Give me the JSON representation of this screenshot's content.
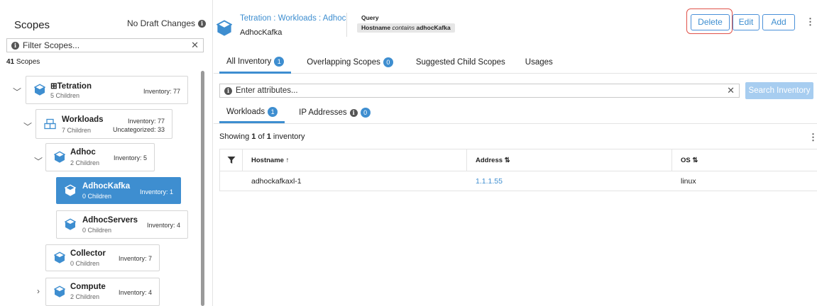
{
  "left": {
    "title": "Scopes",
    "draft_status": "No Draft Changes",
    "filter_placeholder": "Filter Scopes...",
    "scope_count_num": "41",
    "scope_count_label": "Scopes",
    "tree": [
      {
        "name": "Tetration",
        "prefix": "⊞",
        "children": "5 Children",
        "inventory": "Inventory: 77",
        "expanded": true
      },
      {
        "name": "Workloads",
        "children": "7 Children",
        "inventory": "Inventory: 77",
        "uncategorized": "Uncategorized: 33",
        "expanded": true
      },
      {
        "name": "Adhoc",
        "children": "2 Children",
        "inventory": "Inventory: 5",
        "expanded": true
      },
      {
        "name": "AdhocKafka",
        "children": "0 Children",
        "inventory": "Inventory: 1",
        "selected": true
      },
      {
        "name": "AdhocServers",
        "children": "0 Children",
        "inventory": "Inventory: 4"
      },
      {
        "name": "Collector",
        "children": "0 Children",
        "inventory": "Inventory: 7"
      },
      {
        "name": "Compute",
        "children": "2 Children",
        "inventory": "Inventory: 4",
        "expanded": false
      }
    ]
  },
  "header": {
    "breadcrumb": [
      "Tetration",
      "Workloads",
      "Adhoc"
    ],
    "breadcrumb_sep": " : ",
    "scope_name": "AdhocKafka",
    "query_title": "Query",
    "query_field": "Hostname",
    "query_op": "contains",
    "query_value": "adhocKafka",
    "buttons": {
      "delete": "Delete",
      "edit": "Edit",
      "add": "Add"
    }
  },
  "tabs": [
    {
      "label": "All Inventory",
      "badge": "1",
      "active": true
    },
    {
      "label": "Overlapping Scopes",
      "badge": "0"
    },
    {
      "label": "Suggested Child Scopes"
    },
    {
      "label": "Usages"
    }
  ],
  "inventory": {
    "attr_placeholder": "Enter attributes...",
    "search_button": "Search Inventory",
    "subtabs": [
      {
        "label": "Workloads",
        "badge": "1",
        "active": true
      },
      {
        "label": "IP Addresses",
        "badge": "0",
        "info": true
      }
    ],
    "showing_prefix": "Showing",
    "showing_count": "1",
    "showing_of": "of",
    "showing_total": "1",
    "showing_suffix": "inventory",
    "columns": [
      "Hostname ↑",
      "Address ⇅",
      "OS ⇅"
    ],
    "rows": [
      {
        "hostname": "adhockafkaxl-1",
        "address": "1.1.1.55",
        "os": "linux"
      }
    ]
  },
  "colors": {
    "accent": "#3e8ed0",
    "highlight": "#e0524a",
    "selected_bg": "#3e8ed0"
  }
}
